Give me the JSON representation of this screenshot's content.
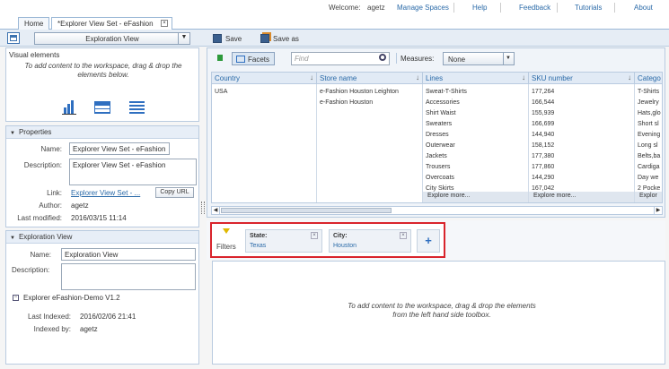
{
  "top_nav": {
    "welcome_label": "Welcome:",
    "user": "agetz",
    "links": [
      "Manage Spaces",
      "Help",
      "Feedback",
      "Tutorials",
      "About"
    ]
  },
  "tabs": [
    {
      "label": "Home"
    },
    {
      "label": "*Explorer View Set - eFashion"
    }
  ],
  "toolbar": {
    "view_select": "Exploration View",
    "save_label": "Save",
    "save_as_label": "Save as"
  },
  "visual_elements": {
    "title": "Visual elements",
    "hint": "To add content to the workspace, drag & drop the elements below."
  },
  "properties": {
    "title": "Properties",
    "name_label": "Name:",
    "name_value": "Explorer View Set - eFashion",
    "description_label": "Description:",
    "description_value": "Explorer View Set - eFashion",
    "link_label": "Link:",
    "link_value": "Explorer View Set - ...",
    "copy_url_label": "Copy URL",
    "author_label": "Author:",
    "author_value": "agetz",
    "modified_label": "Last modified:",
    "modified_value": "2016/03/15 11:14"
  },
  "exploration_view": {
    "title": "Exploration View",
    "name_label": "Name:",
    "name_value": "Exploration View",
    "description_label": "Description:",
    "description_value": "",
    "source": "Explorer eFashion-Demo V1.2",
    "indexed_label": "Last Indexed:",
    "indexed_value": "2016/02/06 21:41",
    "indexed_by_label": "Indexed by:",
    "indexed_by_value": "agetz"
  },
  "facets_bar": {
    "facets_label": "Facets",
    "find_placeholder": "Find",
    "measures_label": "Measures:",
    "measures_value": "None"
  },
  "facet_columns": [
    {
      "header": "Country",
      "values": [
        "USA"
      ],
      "more": ""
    },
    {
      "header": "Store name",
      "values": [
        "e-Fashion Houston Leighton",
        "e-Fashion Houston"
      ],
      "more": ""
    },
    {
      "header": "Lines",
      "values": [
        "Sweat-T-Shirts",
        "Accessories",
        "Shirt Waist",
        "Sweaters",
        "Dresses",
        "Outerwear",
        "Jackets",
        "Trousers",
        "Overcoats",
        "City Skirts"
      ],
      "more": "Explore more..."
    },
    {
      "header": "SKU number",
      "values": [
        "177,264",
        "166,544",
        "155,939",
        "166,699",
        "144,940",
        "158,152",
        "177,380",
        "177,860",
        "144,290",
        "167,042"
      ],
      "more": "Explore more..."
    },
    {
      "header": "Catego",
      "values": [
        "T-Shirts",
        "Jewelry",
        "Hats,glo",
        "Short sl",
        "Evening",
        "Long sl",
        "Belts,ba",
        "Cardiga",
        "Day we",
        "2 Pocke"
      ],
      "more": "Explor"
    }
  ],
  "filters": {
    "label": "Filters",
    "chips": [
      {
        "title": "State:",
        "value": "Texas"
      },
      {
        "title": "City:",
        "value": "Houston"
      }
    ]
  },
  "workspace": {
    "hint": "To add content to the workspace, drag & drop the elements from the left hand side toolbox."
  },
  "colors": {
    "accent": "#2a6aa8",
    "highlight_border": "#d9242c",
    "panel_border": "#b9cbe0",
    "header_bg": "#e7eef7"
  }
}
